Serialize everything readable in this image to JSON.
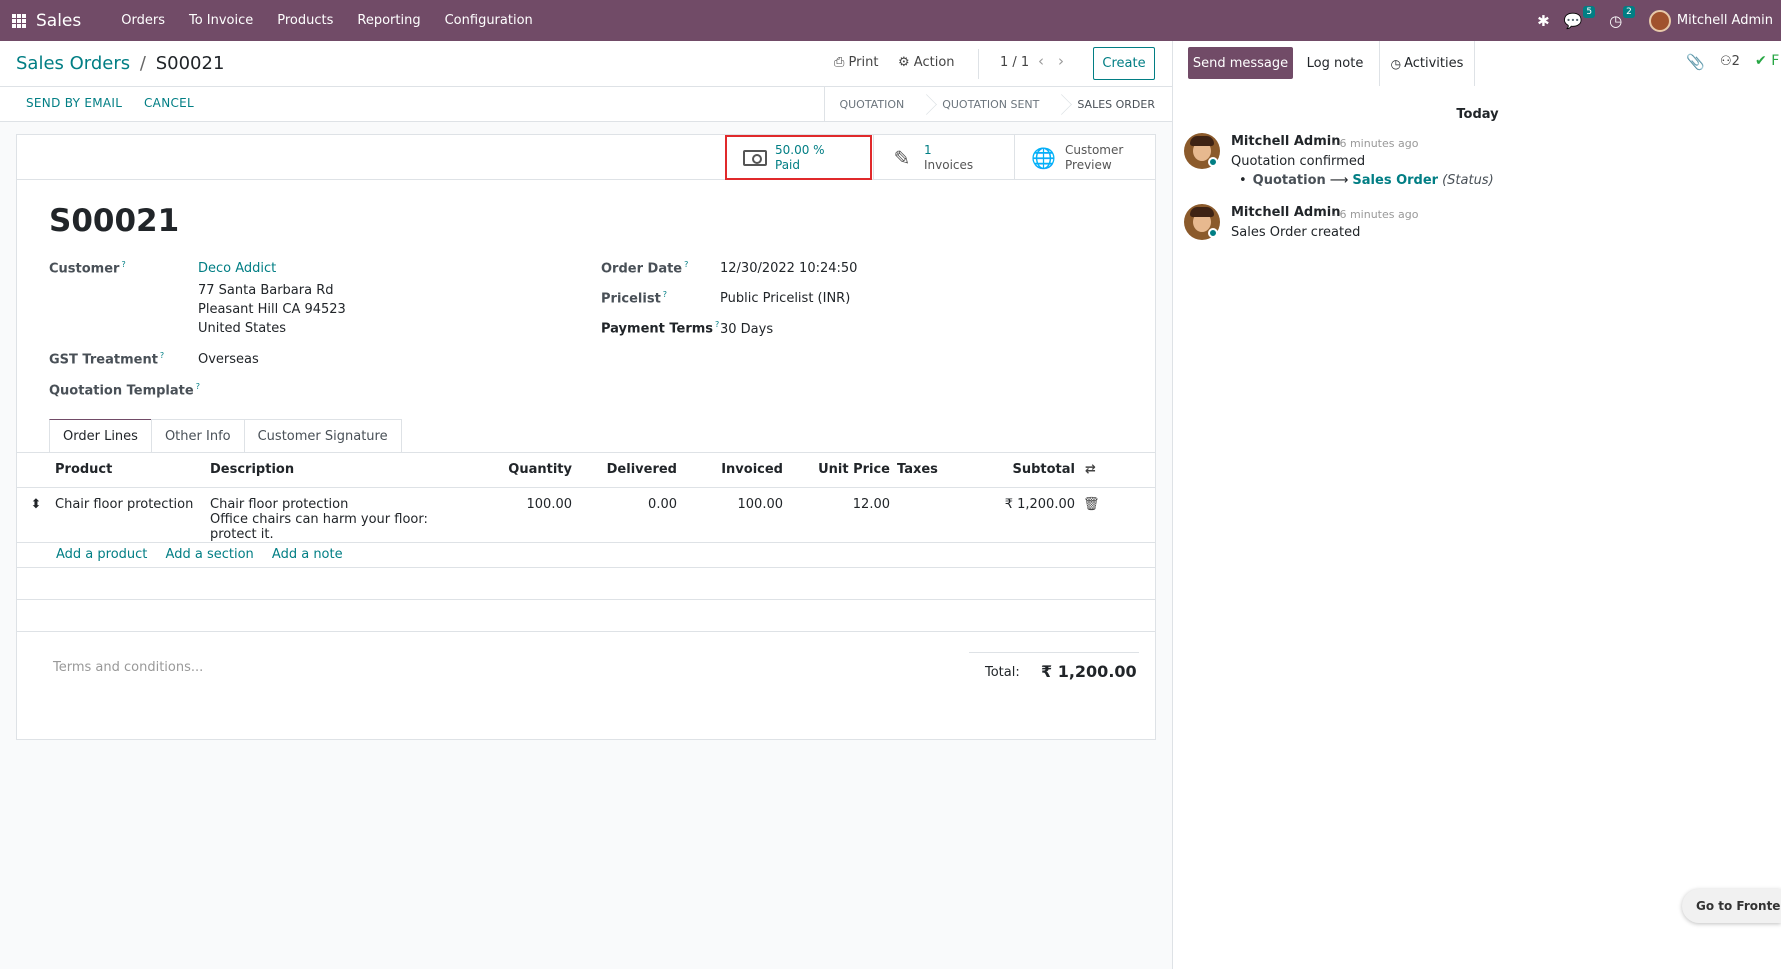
{
  "navbar": {
    "app_name": "Sales",
    "menu": [
      "Orders",
      "To Invoice",
      "Products",
      "Reporting",
      "Configuration"
    ],
    "messages_count": "5",
    "activities_count": "2",
    "user_name": "Mitchell Admin"
  },
  "control_panel": {
    "breadcrumb_parent": "Sales Orders",
    "breadcrumb_separator": "/",
    "breadcrumb_current": "S00021",
    "print_label": "Print",
    "action_label": "Action",
    "pager": "1 / 1",
    "create_label": "Create"
  },
  "status_bar": {
    "send_by_email": "SEND BY EMAIL",
    "cancel": "CANCEL",
    "stages": [
      "QUOTATION",
      "QUOTATION SENT",
      "SALES ORDER"
    ],
    "active_stage": "SALES ORDER"
  },
  "smart_buttons": {
    "paid_value": "50.00 %",
    "paid_label": "Paid",
    "invoices_value": "1",
    "invoices_label": "Invoices",
    "preview_line1": "Customer",
    "preview_line2": "Preview"
  },
  "form": {
    "title": "S00021",
    "customer_label": "Customer",
    "customer_name": "Deco Addict",
    "address_line1": "77 Santa Barbara Rd",
    "address_line2": "Pleasant Hill CA 94523",
    "address_line3": "United States",
    "gst_label": "GST Treatment",
    "gst_value": "Overseas",
    "template_label": "Quotation Template",
    "order_date_label": "Order Date",
    "order_date_value": "12/30/2022 10:24:50",
    "pricelist_label": "Pricelist",
    "pricelist_value": "Public Pricelist (INR)",
    "payment_terms_label": "Payment Terms",
    "payment_terms_value": "30 Days",
    "help_mark": "?"
  },
  "tabs": [
    "Order Lines",
    "Other Info",
    "Customer Signature"
  ],
  "order_lines": {
    "headers": {
      "product": "Product",
      "description": "Description",
      "quantity": "Quantity",
      "delivered": "Delivered",
      "invoiced": "Invoiced",
      "unit_price": "Unit Price",
      "taxes": "Taxes",
      "subtotal": "Subtotal"
    },
    "rows": [
      {
        "product": "Chair floor protection",
        "description_line1": "Chair floor protection",
        "description_line2": "Office chairs can harm your floor: protect it.",
        "quantity": "100.00",
        "delivered": "0.00",
        "invoiced": "100.00",
        "unit_price": "12.00",
        "taxes": "",
        "subtotal": "₹ 1,200.00"
      }
    ],
    "add_product": "Add a product",
    "add_section": "Add a section",
    "add_note": "Add a note"
  },
  "footer": {
    "terms_placeholder": "Terms and conditions...",
    "total_label": "Total:",
    "total_value": "₹ 1,200.00"
  },
  "chatter": {
    "send_message": "Send message",
    "log_note": "Log note",
    "activities": "Activities",
    "followers_count": "2",
    "follow_label": "F",
    "date_separator": "Today",
    "messages": [
      {
        "author": "Mitchell Admin",
        "ago": "- 6 minutes ago",
        "body": "Quotation confirmed",
        "tracking_old": "Quotation",
        "tracking_arrow": "⟶",
        "tracking_new": "Sales Order",
        "tracking_field": "(Status)"
      },
      {
        "author": "Mitchell Admin",
        "ago": "- 6 minutes ago",
        "body": "Sales Order created"
      }
    ]
  },
  "go_to_frontend": "Go to Frontend",
  "colors": {
    "brand": "#714B67",
    "link": "#017e84",
    "highlight_border": "#e0292b"
  }
}
